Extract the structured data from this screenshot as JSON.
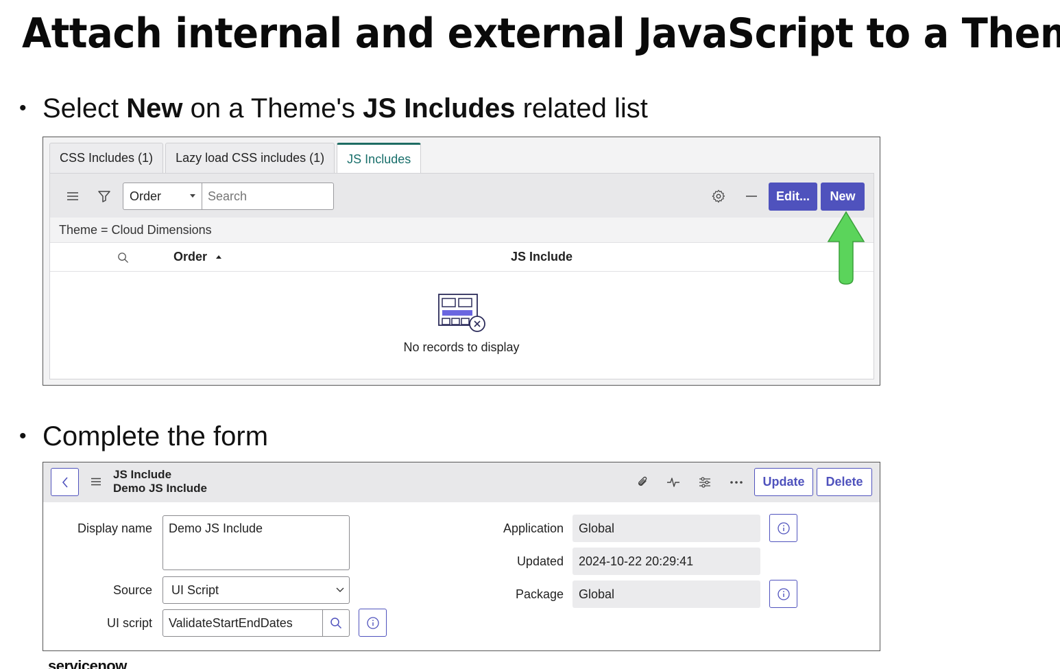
{
  "slide": {
    "title": "Attach internal and external JavaScript to a Theme",
    "bullet1": {
      "pre": "Select ",
      "b1": "New",
      "mid": " on a Theme's ",
      "b2": "JS Includes",
      "post": " related list"
    },
    "bullet2": "Complete the form",
    "logo": "servicenow"
  },
  "related_list": {
    "tabs": [
      "CSS Includes (1)",
      "Lazy load CSS includes (1)",
      "JS Includes"
    ],
    "active_tab": 2,
    "order_select": "Order",
    "search_placeholder": "Search",
    "edit_label": "Edit...",
    "new_label": "New",
    "filter_text": "Theme = Cloud Dimensions",
    "columns": [
      "Order",
      "JS Include"
    ],
    "empty_text": "No records to display",
    "accent": "#4f52bd",
    "arrow_color": "#5bd45b"
  },
  "form": {
    "record_type": "JS Include",
    "record_name": "Demo JS Include",
    "update_label": "Update",
    "delete_label": "Delete",
    "display_name_label": "Display name",
    "display_name_value": "Demo JS Include",
    "source_label": "Source",
    "source_value": "UI Script",
    "ui_script_label": "UI script",
    "ui_script_value": "ValidateStartEndDates",
    "application_label": "Application",
    "application_value": "Global",
    "updated_label": "Updated",
    "updated_value": "2024-10-22 20:29:41",
    "package_label": "Package",
    "package_value": "Global"
  }
}
